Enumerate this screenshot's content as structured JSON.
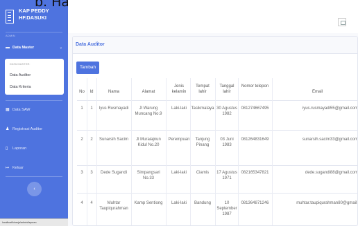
{
  "caption": "b. Halaman Data Auditor",
  "sidebar": {
    "brand": "KAP PEDDY HF.DASUKI",
    "nav_heading": "ADMIN",
    "data_master": "Data Master",
    "submenu_heading": "DATA MASTER:",
    "submenu_items": [
      "Data Auditor",
      "Data Kriteria"
    ],
    "items": [
      "Data SAW",
      "Registrasi Auditor",
      "Laporan",
      "Keluar"
    ],
    "status_url": "localhost/kinerja/admin/laporan"
  },
  "card": {
    "title": "Data Auditor",
    "add_button": "Tambah"
  },
  "table": {
    "headers": [
      "No",
      "Id",
      "Nama",
      "Alamat",
      "Jenis kelamin",
      "Tempat lahir",
      "Tanggal lahir",
      "Nomor telepon",
      "Email"
    ],
    "rows": [
      [
        "1",
        "1",
        "Iyus Rusmayadi",
        "Jl Warung Muncang No.9",
        "Laki-laki",
        "Tasikmalaya",
        "30 Agustus 1982",
        "081274667495",
        "iyus.rusmayadi55@gmail.com"
      ],
      [
        "2",
        "2",
        "Sunarsih Sacim",
        "Jl Muraiajnun Kidul No.20",
        "Perempuan",
        "Tanjung Pinang",
        "03 Juni 1983",
        "081264831649",
        "sunarsih.sacim33@gmail.com"
      ],
      [
        "3",
        "3",
        "Dede Sugandi",
        "Simpangsari No.33",
        "Laki-laki",
        "Ciamis",
        "17 Agustus 1971",
        "082165347821",
        "dede.sugandi88@gmail.com"
      ],
      [
        "4",
        "4",
        "Muhtar Taupiqurahman",
        "Kamp Sentiong",
        "Laki-laki",
        "Bandung",
        "10 September 1987",
        "081364871246",
        "muhtar.taupiqurahman80@gmail."
      ]
    ]
  },
  "icons": {
    "brand": "building-icon",
    "folder": "folder-icon",
    "saw": "table-icon",
    "register": "user-plus-icon",
    "report": "file-icon",
    "logout": "sign-out-icon",
    "toggle": "chevron-left-icon"
  },
  "colors": {
    "primary": "#4e73df",
    "background": "#f8f9fc"
  }
}
